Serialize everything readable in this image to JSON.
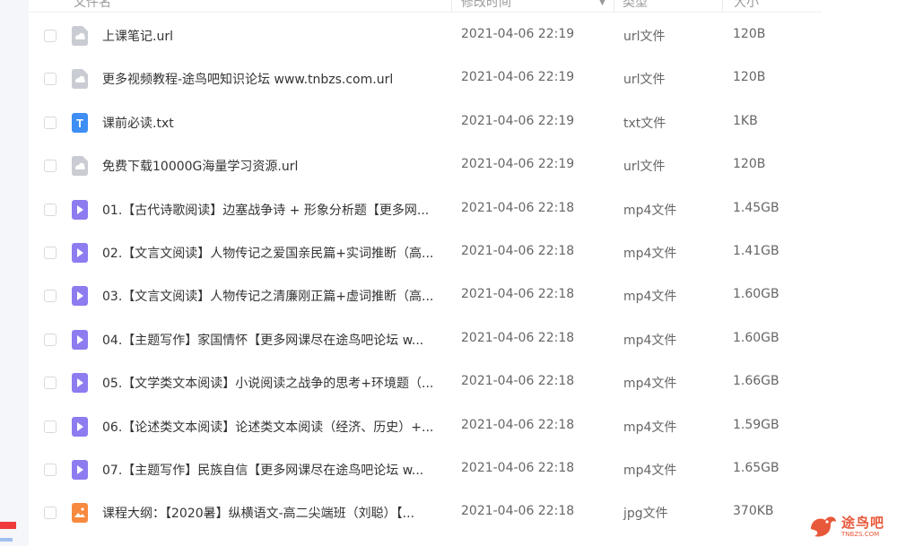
{
  "header": {
    "col_name": "文件名",
    "col_date": "修改时间",
    "col_type": "类型",
    "col_size": "大小"
  },
  "files": [
    {
      "name": "上课笔记.url",
      "date": "2021-04-06 22:19",
      "type": "url文件",
      "size": "120B",
      "icon": "url-file-icon",
      "color": "#c9ccd2"
    },
    {
      "name": "更多视频教程-途鸟吧知识论坛 www.tnbzs.com.url",
      "date": "2021-04-06 22:19",
      "type": "url文件",
      "size": "120B",
      "icon": "url-file-icon",
      "color": "#c9ccd2"
    },
    {
      "name": "课前必读.txt",
      "date": "2021-04-06 22:19",
      "type": "txt文件",
      "size": "1KB",
      "icon": "txt-file-icon",
      "color": "#3f8ef3"
    },
    {
      "name": "免费下载10000G海量学习资源.url",
      "date": "2021-04-06 22:19",
      "type": "url文件",
      "size": "120B",
      "icon": "url-file-icon",
      "color": "#c9ccd2"
    },
    {
      "name": "01.【古代诗歌阅读】边塞战争诗 + 形象分析题【更多网...",
      "date": "2021-04-06 22:18",
      "type": "mp4文件",
      "size": "1.45GB",
      "icon": "video-file-icon",
      "color": "#8c7cf0"
    },
    {
      "name": "02.【文言文阅读】人物传记之爱国亲民篇+实词推断（高...",
      "date": "2021-04-06 22:18",
      "type": "mp4文件",
      "size": "1.41GB",
      "icon": "video-file-icon",
      "color": "#8c7cf0"
    },
    {
      "name": "03.【文言文阅读】人物传记之清廉刚正篇+虚词推断（高...",
      "date": "2021-04-06 22:18",
      "type": "mp4文件",
      "size": "1.60GB",
      "icon": "video-file-icon",
      "color": "#8c7cf0"
    },
    {
      "name": "04.【主题写作】家国情怀【更多网课尽在途鸟吧论坛 w...",
      "date": "2021-04-06 22:18",
      "type": "mp4文件",
      "size": "1.60GB",
      "icon": "video-file-icon",
      "color": "#8c7cf0"
    },
    {
      "name": "05.【文学类文本阅读】小说阅读之战争的思考+环境题（...",
      "date": "2021-04-06 22:18",
      "type": "mp4文件",
      "size": "1.66GB",
      "icon": "video-file-icon",
      "color": "#8c7cf0"
    },
    {
      "name": "06.【论述类文本阅读】论述类文本阅读（经济、历史）+...",
      "date": "2021-04-06 22:18",
      "type": "mp4文件",
      "size": "1.59GB",
      "icon": "video-file-icon",
      "color": "#8c7cf0"
    },
    {
      "name": "07.【主题写作】民族自信【更多网课尽在途鸟吧论坛 w...",
      "date": "2021-04-06 22:18",
      "type": "mp4文件",
      "size": "1.65GB",
      "icon": "video-file-icon",
      "color": "#8c7cf0"
    },
    {
      "name": "课程大纲：【2020暑】纵横语文-高二尖端班（刘聪）【...",
      "date": "2021-04-06 22:18",
      "type": "jpg文件",
      "size": "370KB",
      "icon": "image-file-icon",
      "color": "#f7893f"
    }
  ],
  "watermark": {
    "text": "途鸟吧",
    "sub": "TNBZS.COM",
    "color": "#e8583a"
  }
}
